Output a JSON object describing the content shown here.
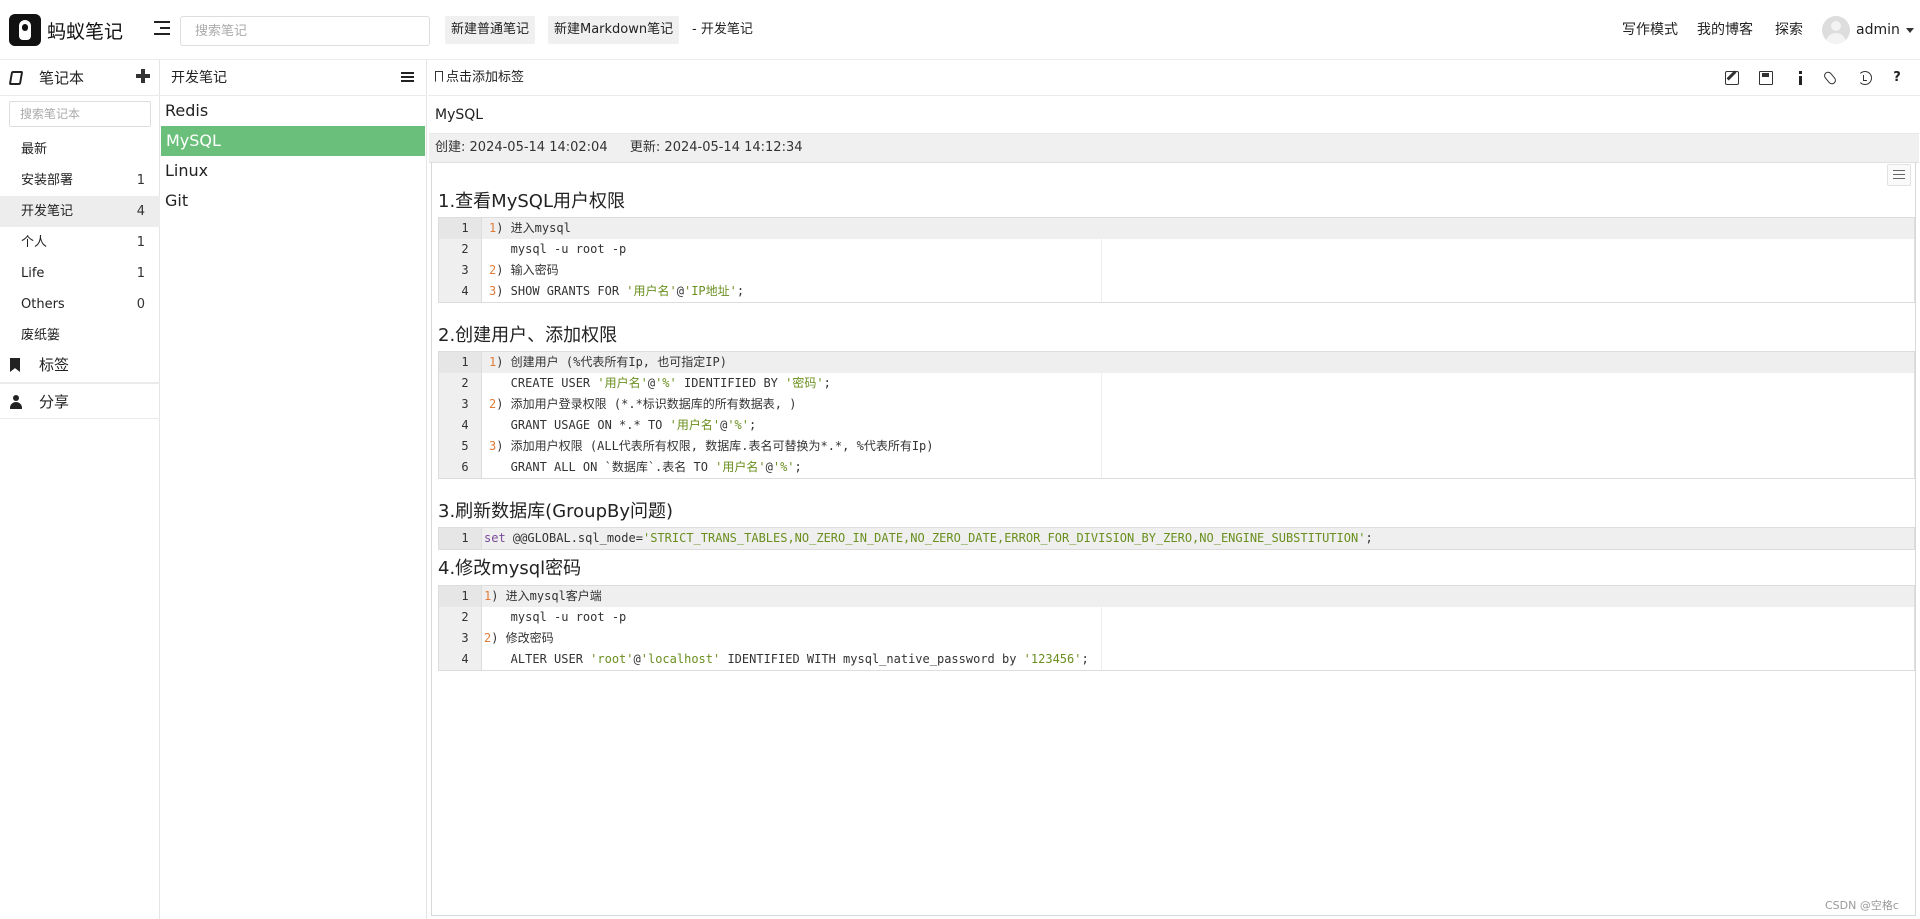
{
  "app": {
    "name": "蚂蚁笔记"
  },
  "header": {
    "search_placeholder": "搜索笔记",
    "new_normal_label": "新建普通笔记",
    "new_markdown_label": "新建Markdown笔记",
    "current_notebook": "- 开发笔记",
    "nav_write": "写作模式",
    "nav_blog": "我的博客",
    "nav_explore": "探索",
    "user": "admin"
  },
  "sidebar": {
    "notebook_label": "笔记本",
    "notebook_search_placeholder": "搜索笔记本",
    "notebooks": [
      {
        "label": "最新",
        "count": ""
      },
      {
        "label": "安装部署",
        "count": "1"
      },
      {
        "label": "开发笔记",
        "count": "4"
      },
      {
        "label": "个人",
        "count": "1"
      },
      {
        "label": "Life",
        "count": "1"
      },
      {
        "label": "Others",
        "count": "0"
      },
      {
        "label": "废纸篓",
        "count": ""
      }
    ],
    "tags_label": "标签",
    "share_label": "分享"
  },
  "note_list": {
    "title": "开发笔记",
    "items": [
      "Redis",
      "MySQL",
      "Linux",
      "Git"
    ]
  },
  "editor": {
    "add_tag_label": "点击添加标签",
    "help_label": "?",
    "note_title": "MySQL",
    "created_label": "创建:",
    "created": "2024-05-14 14:02:04",
    "updated_label": "更新:",
    "updated": "2024-05-14 14:12:34",
    "sections": [
      {
        "heading": "1.查看MySQL用户权限",
        "lines": [
          "1) 进入mysql",
          "   mysql -u root -p",
          "2) 输入密码",
          "3) SHOW GRANTS FOR '用户名'@'IP地址';"
        ]
      },
      {
        "heading": "2.创建用户、添加权限",
        "lines": [
          "1) 创建用户 (%代表所有Ip, 也可指定IP)",
          "   CREATE USER '用户名'@'%' IDENTIFIED BY '密码';",
          "2) 添加用户登录权限 (*.*标识数据库的所有数据表, )",
          "   GRANT USAGE ON *.* TO '用户名'@'%';",
          "3) 添加用户权限 (ALL代表所有权限, 数据库.表名可替换为*.*, %代表所有Ip)",
          "   GRANT ALL ON `数据库`.表名 TO '用户名'@'%';"
        ]
      },
      {
        "heading": "3.刷新数据库(GroupBy问题)",
        "lines": [
          "set @@GLOBAL.sql_mode='STRICT_TRANS_TABLES,NO_ZERO_IN_DATE,NO_ZERO_DATE,ERROR_FOR_DIVISION_BY_ZERO,NO_ENGINE_SUBSTITUTION';"
        ]
      },
      {
        "heading": "4.修改mysql密码",
        "lines": [
          "1) 进入mysql客户端",
          "   mysql -u root -p",
          "2) 修改密码",
          "   ALTER USER 'root'@'localhost' IDENTIFIED WITH mysql_native_password by '123456';"
        ]
      }
    ]
  },
  "watermark": "CSDN @空格c",
  "colors": {
    "accent": "#6ac07a",
    "number": "#e07c3a",
    "string": "#6a8f1f"
  }
}
